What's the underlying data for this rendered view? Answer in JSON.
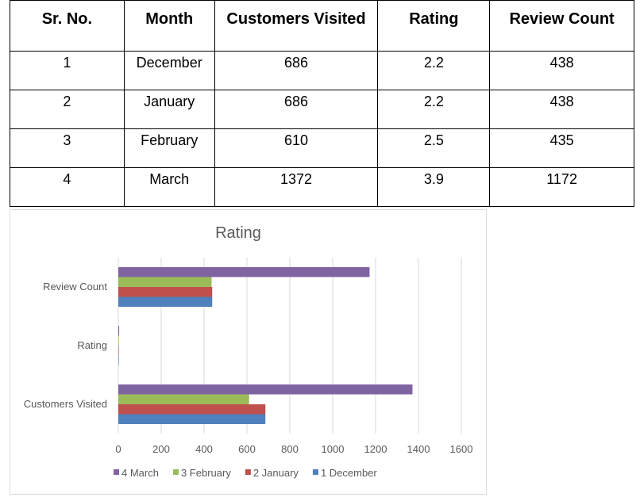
{
  "table": {
    "headers": [
      "Sr. No.",
      "Month",
      "Customers Visited",
      "Rating",
      "Review Count"
    ],
    "rows": [
      [
        "1",
        "December",
        "686",
        "2.2",
        "438"
      ],
      [
        "2",
        "January",
        "686",
        "2.2",
        "438"
      ],
      [
        "3",
        "February",
        "610",
        "2.5",
        "435"
      ],
      [
        "4",
        "March",
        "1372",
        "3.9",
        "1172"
      ]
    ]
  },
  "chart_data": {
    "type": "bar",
    "orientation": "horizontal",
    "title": "Rating",
    "categories": [
      "Customers Visited",
      "Rating",
      "Review Count"
    ],
    "series": [
      {
        "name": "1 December",
        "color": "#4f81bd",
        "values": [
          686,
          2.2,
          438
        ]
      },
      {
        "name": "2 January",
        "color": "#c0504d",
        "values": [
          686,
          2.2,
          438
        ]
      },
      {
        "name": "3 February",
        "color": "#9bbb59",
        "values": [
          610,
          2.5,
          435
        ]
      },
      {
        "name": "4 March",
        "color": "#8064a2",
        "values": [
          1372,
          3.9,
          1172
        ]
      }
    ],
    "xlim": [
      0,
      1600
    ],
    "xticks": [
      0,
      200,
      400,
      600,
      800,
      1000,
      1200,
      1400,
      1600
    ],
    "legend_position": "bottom",
    "legend_order": [
      "4 March",
      "3 February",
      "2 January",
      "1 December"
    ],
    "grid": true
  }
}
